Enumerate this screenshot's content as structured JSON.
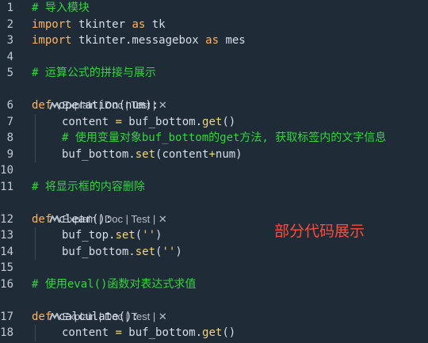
{
  "theme": {
    "background": "#1f2b37",
    "comment": "#33d63d",
    "keyword": "#ffb25f",
    "text": "#d6deeb",
    "line_number": "#c2c9d1",
    "annotation": "#ff4b3b"
  },
  "code_lens_items": [
    "Explain | Doc | Test | ✕",
    "Explain | Doc | Test | ✕",
    "Explain | Doc | Test | ✕"
  ],
  "line_numbers": [
    "1",
    "2",
    "3",
    "4",
    "5",
    "6",
    "7",
    "8",
    "9",
    "10",
    "11",
    "12",
    "13",
    "14",
    "15",
    "16",
    "17",
    "18"
  ],
  "lines": {
    "l1_comment": "# 导入模块",
    "l2_kw": "import",
    "l2_rest": " tkinter ",
    "l2_as": "as",
    "l2_alias": " tk",
    "l3_kw": "import",
    "l3_rest": " tkinter.messagebox ",
    "l3_as": "as",
    "l3_alias": " mes",
    "l5_comment": "# 运算公式的拼接与展示",
    "l6_kw": "def",
    "l6_rest": " operation(num):",
    "l7_a": "content ",
    "l7_b": "=",
    "l7_c": " buf_bottom.",
    "l7_d": "get",
    "l7_e": "()",
    "l8_comment": "# 使用变量对象buf_bottom的get方法, 获取标签内的文字信息",
    "l9_a": "buf_bottom.",
    "l9_b": "set",
    "l9_c": "(content",
    "l9_d": "+",
    "l9_e": "num)",
    "l11_comment": "# 将显示框的内容删除",
    "l12_kw": "def",
    "l12_rest": " clear():",
    "l13_a": "buf_top.",
    "l13_b": "set",
    "l13_c": "(",
    "l13_d": "''",
    "l13_e": ")",
    "l14_a": "buf_bottom.",
    "l14_b": "set",
    "l14_c": "(",
    "l14_d": "''",
    "l14_e": ")",
    "l16_comment": "# 使用eval()函数对表达式求值",
    "l17_kw": "def",
    "l17_rest": " calculate():",
    "l18_a": "content ",
    "l18_b": "=",
    "l18_c": " buf_bottom.",
    "l18_d": "get",
    "l18_e": "()"
  },
  "annotation": "部分代码展示"
}
